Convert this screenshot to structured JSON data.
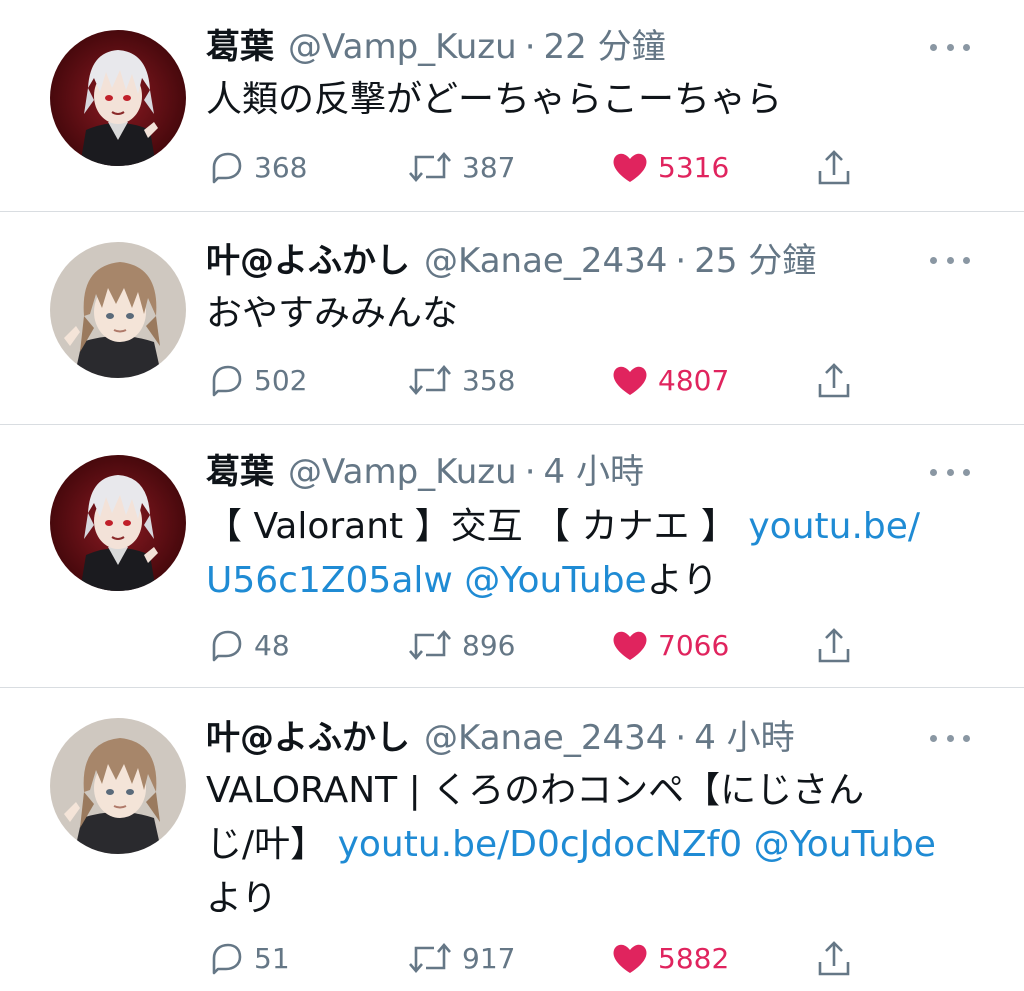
{
  "tweets": [
    {
      "name": "葛葉",
      "handle": "@Vamp_Kuzu",
      "dot": "·",
      "time": "22 分鐘",
      "text_plain": "人類の反撃がどーちゃらこーちゃら",
      "replies": "368",
      "retweets": "387",
      "likes": "5316",
      "avatar": "avatar-kuzuha"
    },
    {
      "name": "叶@よふかし",
      "handle": "@Kanae_2434",
      "dot": "·",
      "time": "25 分鐘",
      "text_plain": "おやすみみんな",
      "replies": "502",
      "retweets": "358",
      "likes": "4807",
      "avatar": "avatar-kanae"
    },
    {
      "name": "葛葉",
      "handle": "@Vamp_Kuzu",
      "dot": "·",
      "time": "4 小時",
      "text_pre": "【 Valorant 】交互 【 カナエ 】 ",
      "link1": "youtu.be/U56c1Z05alw",
      "link1_a": "youtu.be/",
      "link1_b": "U56c1Z05alw",
      "mid": " ",
      "link2": "@YouTube",
      "text_post": "より",
      "replies": "48",
      "retweets": "896",
      "likes": "7066",
      "avatar": "avatar-kuzuha"
    },
    {
      "name": "叶@よふかし",
      "handle": "@Kanae_2434",
      "dot": "·",
      "time": "4 小時",
      "text_pre": "VALORANT | くろのわコンペ【にじさんじ/叶】 ",
      "text_pre_a": "VALORANT | くろのわコンペ【にじさん",
      "text_pre_b": "じ/叶】 ",
      "link1": "youtu.be/D0cJdocNZf0",
      "mid": " ",
      "link2": "@YouTube",
      "text_post": "より",
      "replies": "51",
      "retweets": "917",
      "likes": "5882",
      "avatar": "avatar-kanae"
    }
  ],
  "colors": {
    "like": "#e0245e",
    "link": "#1f8bd4",
    "muted": "#657786",
    "divider": "#d9dde1"
  },
  "icons": [
    "reply-icon",
    "retweet-icon",
    "heart-icon",
    "share-icon",
    "more-icon"
  ]
}
